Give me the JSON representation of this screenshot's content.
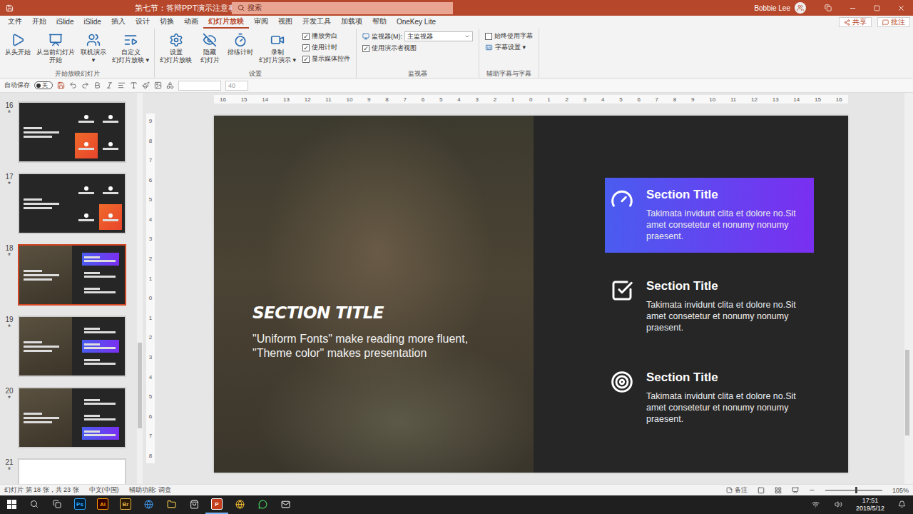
{
  "window": {
    "title": "第七节：答辩PPT演示注意事项.pptx",
    "search": "搜索",
    "user": "Bobbie Lee"
  },
  "menu_tabs": [
    {
      "label": "文件",
      "selected": false
    },
    {
      "label": "开始",
      "selected": false
    },
    {
      "label": "iSlide",
      "selected": false
    },
    {
      "label": "iSlide",
      "selected": false
    },
    {
      "label": "插入",
      "selected": false
    },
    {
      "label": "设计",
      "selected": false
    },
    {
      "label": "切换",
      "selected": false
    },
    {
      "label": "动画",
      "selected": false
    },
    {
      "label": "幻灯片放映",
      "selected": true
    },
    {
      "label": "审阅",
      "selected": false
    },
    {
      "label": "视图",
      "selected": false
    },
    {
      "label": "开发工具",
      "selected": false
    },
    {
      "label": "加载项",
      "selected": false
    },
    {
      "label": "帮助",
      "selected": false
    },
    {
      "label": "OneKey Lite",
      "selected": false
    }
  ],
  "menu_actions": [
    "共享",
    "批注"
  ],
  "ribbon": {
    "groups": [
      {
        "label": "开始放映幻灯片",
        "buttons": [
          {
            "lines": [
              "从头开始"
            ]
          },
          {
            "lines": [
              "从当前幻灯片",
              "开始"
            ]
          },
          {
            "lines": [
              "联机演示",
              "▾"
            ]
          },
          {
            "lines": [
              "自定义",
              "幻灯片放映 ▾"
            ]
          }
        ],
        "checks": [],
        "links": []
      },
      {
        "label": "设置",
        "buttons": [
          {
            "lines": [
              "设置",
              "幻灯片放映"
            ]
          },
          {
            "lines": [
              "隐藏",
              "幻灯片"
            ]
          },
          {
            "lines": [
              "排练计时"
            ]
          },
          {
            "lines": [
              "录制",
              "幻灯片演示 ▾"
            ]
          }
        ],
        "checks": [
          {
            "label": "播放旁白",
            "checked": true
          },
          {
            "label": "使用计时",
            "checked": true
          },
          {
            "label": "显示媒体控件",
            "checked": true
          }
        ],
        "links": []
      },
      {
        "label": "监视器",
        "buttons": [],
        "select": {
          "label": "监视器(M):",
          "value": "主监视器"
        },
        "checks": [
          {
            "label": "使用演示者视图",
            "checked": true
          }
        ],
        "links": []
      },
      {
        "label": "辅助字幕与字幕",
        "buttons": [],
        "checks": [
          {
            "label": "始终使用字幕",
            "checked": false
          }
        ],
        "links": [
          "字幕设置 ▾"
        ]
      }
    ]
  },
  "quick_toolbar": {
    "autosave_label": "自动保存",
    "autosave_on": false,
    "autosave_state": "关",
    "font_name": "",
    "font_size": "40"
  },
  "thumbnails": [
    {
      "number": "16",
      "mark": "*",
      "selected": false,
      "kind": "grid",
      "highlight": 2
    },
    {
      "number": "17",
      "mark": "*",
      "selected": false,
      "kind": "grid",
      "highlight": 3
    },
    {
      "number": "18",
      "mark": "*",
      "selected": true,
      "kind": "photo",
      "highlight": 0
    },
    {
      "number": "19",
      "mark": "*",
      "selected": false,
      "kind": "photo",
      "highlight": 1
    },
    {
      "number": "20",
      "mark": "*",
      "selected": false,
      "kind": "photo",
      "highlight": 2
    },
    {
      "number": "21",
      "mark": "*",
      "selected": false,
      "kind": "light",
      "highlight": 0
    }
  ],
  "rulers": {
    "horizontal": [
      "16",
      "15",
      "14",
      "13",
      "12",
      "11",
      "10",
      "9",
      "8",
      "7",
      "6",
      "5",
      "4",
      "3",
      "2",
      "1",
      "0",
      "1",
      "2",
      "3",
      "4",
      "5",
      "6",
      "7",
      "8",
      "9",
      "10",
      "11",
      "12",
      "13",
      "14",
      "15",
      "16"
    ],
    "vertical": [
      "9",
      "8",
      "7",
      "6",
      "5",
      "4",
      "3",
      "2",
      "1",
      "0",
      "1",
      "2",
      "3",
      "4",
      "5",
      "6",
      "7",
      "8"
    ]
  },
  "slide": {
    "title": "SECTION TITLE",
    "quote": [
      "\"Uniform Fonts\" make reading more fluent,",
      "\"Theme color\" makes presentation"
    ],
    "items": [
      {
        "title": "Section Title",
        "body": "Takimata invidunt clita et dolore no.Sit amet consetetur et nonumy nonumy praesent.",
        "selected": true
      },
      {
        "title": "Section Title",
        "body": "Takimata invidunt clita et dolore no.Sit amet consetetur et nonumy nonumy praesent.",
        "selected": false
      },
      {
        "title": "Section Title",
        "body": "Takimata invidunt clita et dolore no.Sit amet consetetur et nonumy nonumy praesent.",
        "selected": false
      }
    ]
  },
  "status_bar": {
    "slide_info": "幻灯片 第 18 张，共 23 张",
    "language": "中文(中国)",
    "accessibility": "辅助功能: 调查",
    "notes": "备注",
    "zoom": "105%",
    "zoom_level": 0.55
  },
  "taskbar": {
    "apps": [
      {
        "label": "Ps",
        "color": "#31a8ff",
        "bg": "#001e36",
        "active": false
      },
      {
        "label": "Ai",
        "color": "#ff9a00",
        "bg": "#330000",
        "active": false
      },
      {
        "label": "Br",
        "color": "#e6b54a",
        "bg": "#2a1a00",
        "active": false
      },
      {
        "label": "P",
        "color": "#ffffff",
        "bg": "#c43e1c",
        "active": true
      }
    ],
    "time": "17:51",
    "date": "2019/5/12"
  }
}
